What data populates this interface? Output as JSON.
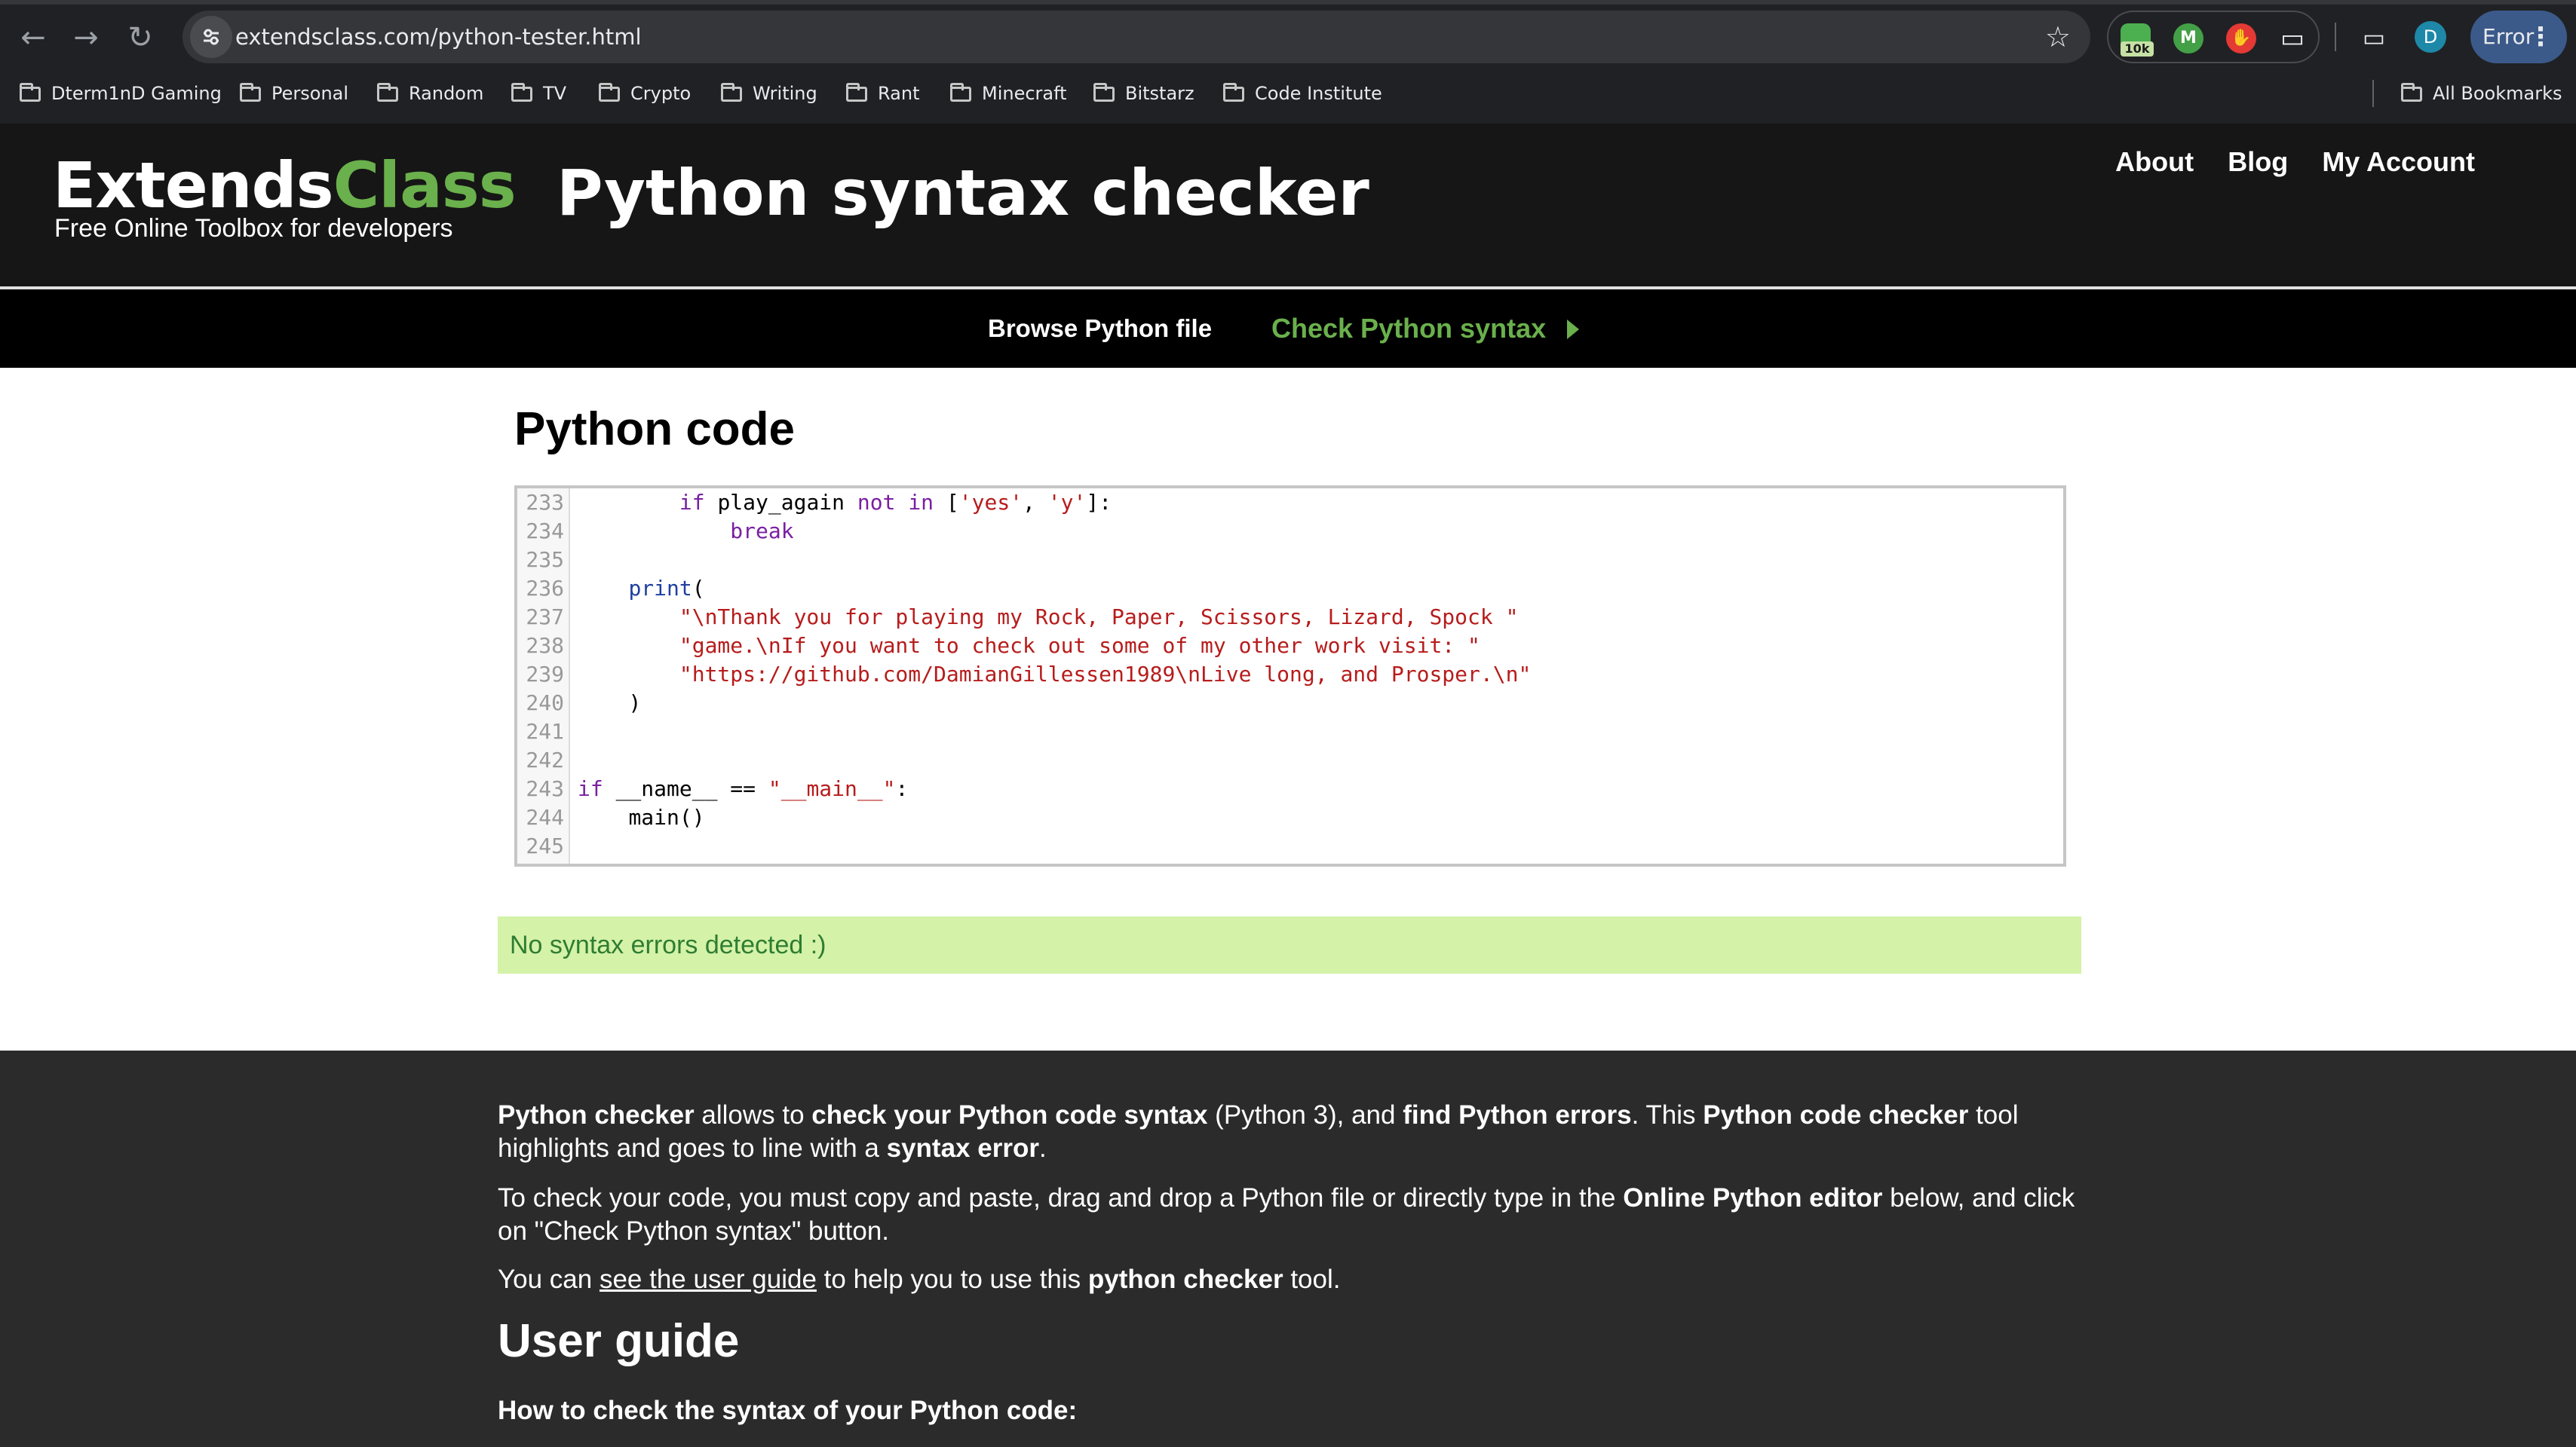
{
  "browser": {
    "url": "extendsclass.com/python-tester.html",
    "profile_initial": "D",
    "error_label": "Error",
    "ext_badge": "10k",
    "ext_m": "M",
    "bookmarks": [
      "Dterm1nD Gaming",
      "Personal",
      "Random",
      "TV",
      "Crypto",
      "Writing",
      "Rant",
      "Minecraft",
      "Bitstarz",
      "Code Institute"
    ],
    "all_bookmarks": "All Bookmarks"
  },
  "site": {
    "logo_main": "Extends",
    "logo_accent": "Class",
    "tagline": "Free Online Toolbox for developers",
    "page_title": "Python syntax checker",
    "nav": [
      "About",
      "Blog",
      "My Account"
    ],
    "accent_color": "#6ab04c"
  },
  "actions": {
    "browse": "Browse Python file",
    "check": "Check Python syntax"
  },
  "editor": {
    "heading": "Python code",
    "lines": [
      {
        "n": "233",
        "text": "        if play_again not in ['yes', 'y']:"
      },
      {
        "n": "234",
        "text": "            break"
      },
      {
        "n": "235",
        "text": ""
      },
      {
        "n": "236",
        "text": "    print("
      },
      {
        "n": "237",
        "text": "        \"\\nThank you for playing my Rock, Paper, Scissors, Lizard, Spock \""
      },
      {
        "n": "238",
        "text": "        \"game.\\nIf you want to check out some of my other work visit: \""
      },
      {
        "n": "239",
        "text": "        \"https://github.com/DamianGillessen1989\\nLive long, and Prosper.\\n\""
      },
      {
        "n": "240",
        "text": "    )"
      },
      {
        "n": "241",
        "text": ""
      },
      {
        "n": "242",
        "text": ""
      },
      {
        "n": "243",
        "text": "if __name__ == \"__main__\":"
      },
      {
        "n": "244",
        "text": "    main()"
      },
      {
        "n": "245",
        "text": ""
      }
    ]
  },
  "result": {
    "message": "No syntax errors detected :)",
    "color": "#d4f2a8"
  },
  "description": {
    "p1": {
      "a": "Python checker",
      "b": " allows to ",
      "c": "check your Python code syntax",
      "d": " (Python 3), and ",
      "e": "find Python errors",
      "f": ". This ",
      "g": "Python code checker",
      "h": " tool highlights and goes to line with a ",
      "i": "syntax error",
      "j": "."
    },
    "p2": {
      "a": "To check your code, you must copy and paste, drag and drop a Python file or directly type in the ",
      "b": "Online Python editor",
      "c": " below, and click on \"Check Python syntax\" button."
    },
    "p3": {
      "a": "You can ",
      "link": "see the user guide",
      "b": " to help you to use this ",
      "c": "python checker",
      "d": " tool."
    },
    "user_guide_title": "User guide",
    "user_guide_subtitle": "How to check the syntax of your Python code:"
  }
}
